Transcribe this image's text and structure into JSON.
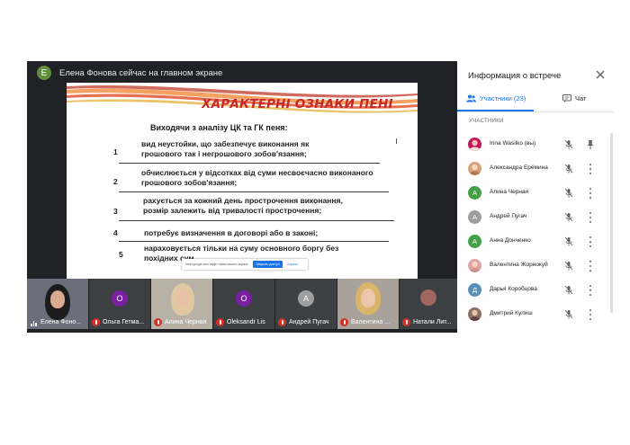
{
  "presenter": {
    "initial": "E",
    "banner_text": "Елена Фонова сейчас на главном экране"
  },
  "slide": {
    "title": "ХАРАКТЕРНІ ОЗНАКИ ПЕНІ",
    "subtitle": "Виходячи з аналізу ЦК та ГК пеня:",
    "points": [
      {
        "num": "1",
        "lines": [
          "вид неустойки, що забезпечує виконання як",
          "грошового  так і негрошового зобов'язання;"
        ]
      },
      {
        "num": "2",
        "lines": [
          "обчислюється у відсотках від суми несвоєчасно виконаного",
          "грошового зобов'язання;"
        ]
      },
      {
        "num": "3",
        "lines": [
          "рахується за кожний день прострочення виконання,",
          "розмір  залежить від тривалості прострочення;"
        ]
      },
      {
        "num": "4",
        "lines": [
          "потребує визначення в договорі або в законі;"
        ]
      },
      {
        "num": "5",
        "lines": [
          "нараховується тільки на суму основного боргу без",
          "похідних сум"
        ]
      }
    ],
    "share_bar": {
      "text": "meet.google.com ведет показ вашего экрана",
      "stop_label": "Закрыть доступ",
      "hide_label": "Скрыть"
    }
  },
  "filmstrip": [
    {
      "name": "Елена Фоно...",
      "type": "video",
      "mic": "on"
    },
    {
      "name": "Ольга Гетма...",
      "type": "avatar",
      "initial": "О",
      "color": "#7b1fa2",
      "mic": "off"
    },
    {
      "name": "Алина Черная",
      "type": "video",
      "mic": "off"
    },
    {
      "name": "Oleksandr Lis",
      "type": "avatar",
      "initial": "O",
      "color": "#7b1fa2",
      "mic": "off"
    },
    {
      "name": "Андрей Пугач",
      "type": "avatar",
      "initial": "А",
      "color": "#9e9e9e",
      "mic": "off"
    },
    {
      "name": "Валентина ...",
      "type": "video",
      "mic": "off"
    },
    {
      "name": "Натали Лит...",
      "type": "photo",
      "mic": "off"
    }
  ],
  "panel": {
    "title": "Информация о встрече",
    "tab_people": "Участники (23)",
    "tab_chat": "Чат",
    "section_label": "УЧАСТНИКИ",
    "participants": [
      {
        "name": "Irina Wasilko (вы)",
        "initial": "I",
        "color": "#c2185b",
        "photo": true
      },
      {
        "name": "Александра Ерёмина",
        "initial": "А",
        "color": "#d7a27a",
        "photo": true
      },
      {
        "name": "Алина Черная",
        "initial": "А",
        "color": "#43a047",
        "photo": false
      },
      {
        "name": "Андрей Пугач",
        "initial": "А",
        "color": "#9e9e9e",
        "photo": false
      },
      {
        "name": "Анна Донченко",
        "initial": "А",
        "color": "#43a047",
        "photo": false
      },
      {
        "name": "Валентина Жорнокуй",
        "initial": "В",
        "color": "#e0a4a4",
        "photo": true
      },
      {
        "name": "Дарья Коробцова",
        "initial": "Д",
        "color": "#5c8fb8",
        "photo": false
      },
      {
        "name": "Дмитрий Кулиш",
        "initial": "Д",
        "color": "#8d6e63",
        "photo": true
      }
    ]
  },
  "colors": {
    "meet_dark": "#202124",
    "accent": "#1a73e8",
    "mic_off": "#d93025",
    "slide_title": "#c62828"
  }
}
